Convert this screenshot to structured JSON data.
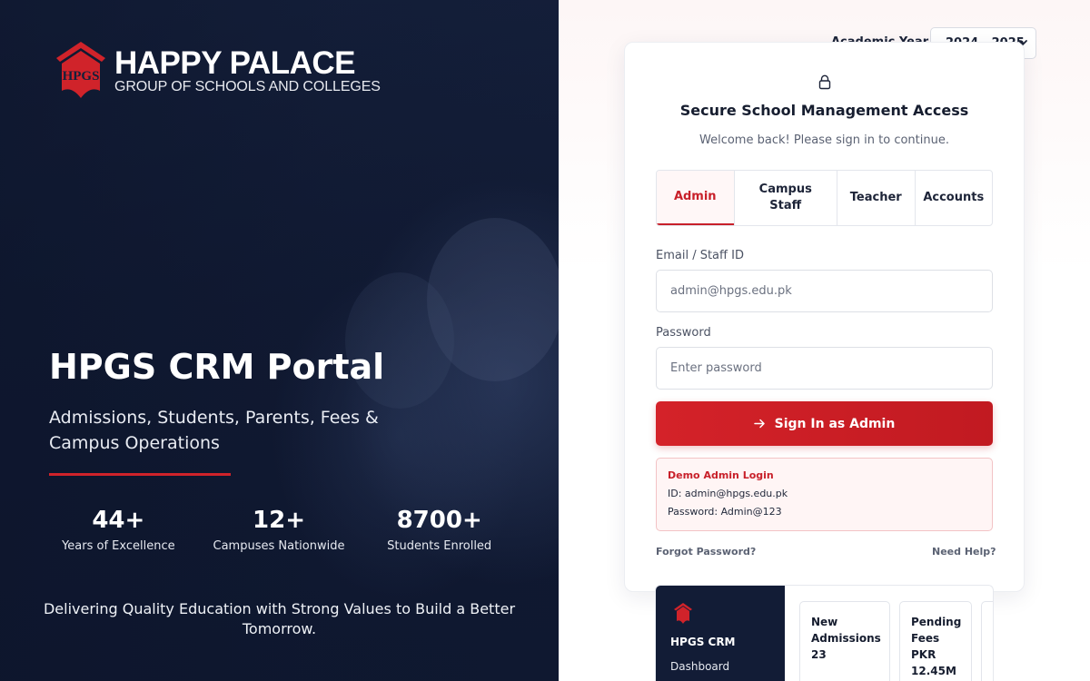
{
  "brand": {
    "logo_monogram": "HPGS",
    "title": "HAPPY PALACE",
    "subtitle": "GROUP OF SCHOOLS AND COLLEGES",
    "accent_color": "#d0232a"
  },
  "hero": {
    "title": "HPGS CRM Portal",
    "subtitle": "Admissions, Students, Parents, Fees & Campus Operations",
    "stats": [
      {
        "value": "44+",
        "label": "Years of Excellence"
      },
      {
        "value": "12+",
        "label": "Campuses Nationwide"
      },
      {
        "value": "8700+",
        "label": "Students Enrolled"
      }
    ],
    "tagline": "Delivering Quality Education with Strong Values to Build a Better Tomorrow."
  },
  "academic_year": {
    "label": "Academic Year",
    "selected": "2024 - 2025",
    "icon": "chevron-down-icon"
  },
  "login": {
    "icon": "lock-icon",
    "title": "Secure School Management Access",
    "subtitle": "Welcome back! Please sign in to continue.",
    "tabs": [
      {
        "label": "Admin",
        "active": true
      },
      {
        "label": "Campus Staff",
        "active": false
      },
      {
        "label": "Teacher",
        "active": false
      },
      {
        "label": "Accounts",
        "active": false
      }
    ],
    "email": {
      "label": "Email / Staff ID",
      "placeholder": "admin@hpgs.edu.pk",
      "value": ""
    },
    "password": {
      "label": "Password",
      "placeholder": "Enter password",
      "value": ""
    },
    "submit_label": "Sign In as Admin",
    "submit_icon": "arrow-right-icon",
    "demo": {
      "title": "Demo Admin Login",
      "id_line": "ID: admin@hpgs.edu.pk",
      "password_line": "Password: Admin@123"
    },
    "forgot_label": "Forgot Password?",
    "help_label": "Need Help?"
  },
  "preview": {
    "app_name": "HPGS CRM",
    "menu_item": "Dashboard",
    "cards": [
      {
        "title": "New Admissions",
        "value": "23"
      },
      {
        "title": "Pending Fees",
        "value": "PKR 12.45M"
      }
    ]
  }
}
